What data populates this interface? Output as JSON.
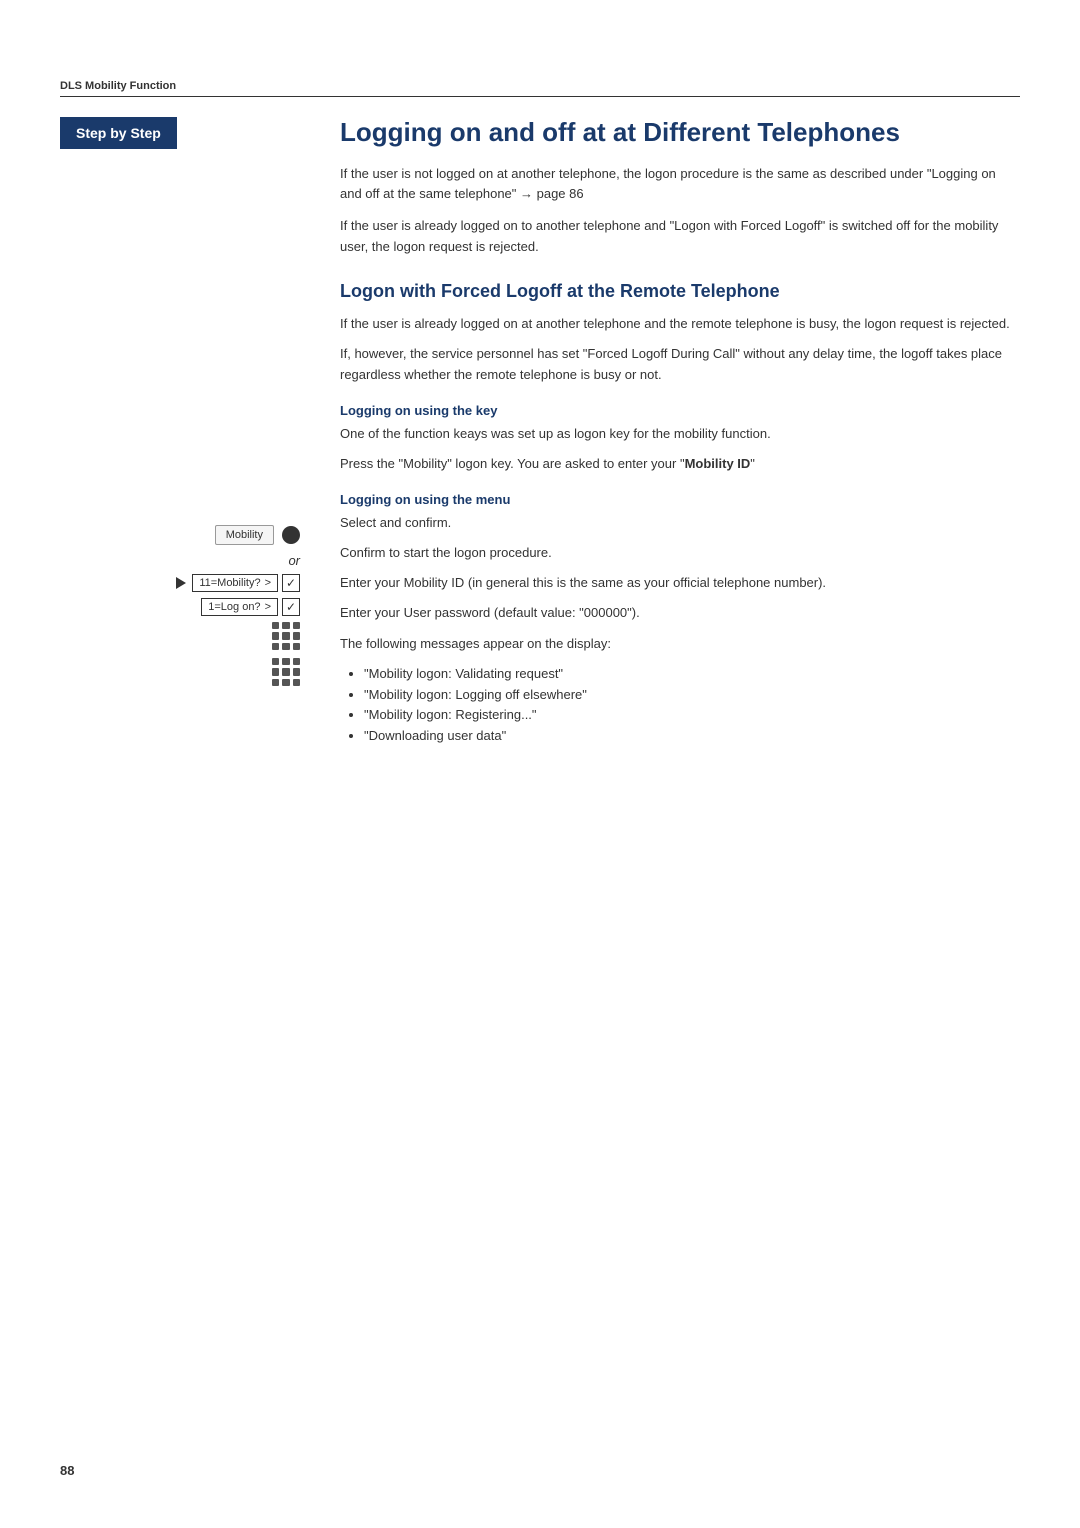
{
  "header": {
    "label": "DLS Mobility Function"
  },
  "left_column": {
    "step_by_step": "Step by Step",
    "mobility_button_label": "Mobility",
    "or_label": "or",
    "menu_item_1": "11=Mobility?",
    "menu_item_1_arrow": ">",
    "menu_item_2": "1=Log on?",
    "menu_item_2_arrow": ">"
  },
  "right_column": {
    "main_title": "Logging on and off at at Different Telephones",
    "intro_para_1": "If the user is not logged on at another telephone, the logon procedure is the same as described under \"Logging on and off at the same telephone\" → page 86",
    "intro_para_2": "If the user is already logged on to another telephone and \"Logon with Forced Logoff\" is switched off for the mobility user, the logon request is rejected.",
    "section_heading": "Logon with Forced Logoff at the Remote Telephone",
    "para_1": "If the user is already logged on at another telephone and the remote telephone is busy, the logon request is rejected.",
    "para_2": "If, however, the service personnel has set \"Forced Logoff During Call\" without any delay time, the logoff takes place regardless whether the remote telephone is busy or not.",
    "sub_heading_key": "Logging on using the key",
    "para_key": "One of the function keays was set up as logon key for the mobility function.",
    "para_mobility_press": "Press the \"Mobility\" logon key. You are asked to enter your \"Mobility ID\"",
    "sub_heading_menu": "Logging on using the menu",
    "select_confirm": "Select and confirm.",
    "confirm_logon": "Confirm to start the logon procedure.",
    "enter_mobility_id": "Enter your Mobility ID (in general this is the same as your official telephone number).",
    "enter_password": "Enter your User password (default value: \"000000\").",
    "messages_intro": "The following messages appear on the display:",
    "bullet_1": "\"Mobility logon: Validating request\"",
    "bullet_2": "\"Mobility logon: Logging off elsewhere\"",
    "bullet_3": "\"Mobility logon: Registering...\"",
    "bullet_4": "\"Downloading user data\""
  },
  "page_number": "88"
}
